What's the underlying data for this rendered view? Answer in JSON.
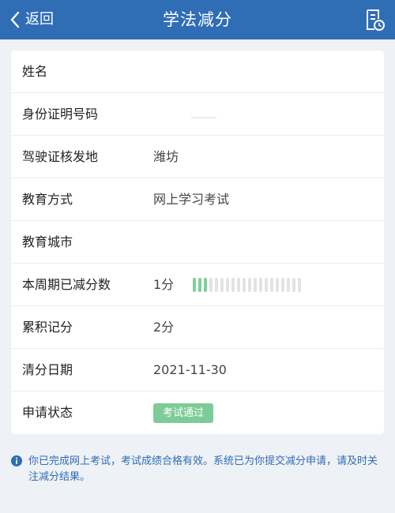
{
  "header": {
    "back_label": "返回",
    "title": "学法减分",
    "icons": {
      "back": "chevron-left-icon",
      "document": "document-clock-icon"
    },
    "color": "#2f6db5"
  },
  "rows": [
    {
      "label": "姓名",
      "value": ""
    },
    {
      "label": "身份证明号码",
      "value": ""
    },
    {
      "label": "驾驶证核发地",
      "value": "潍坊"
    },
    {
      "label": "教育方式",
      "value": "网上学习考试"
    },
    {
      "label": "教育城市",
      "value": ""
    },
    {
      "label": "本周期已减分数",
      "value": "1分",
      "progress": {
        "filled": 3,
        "total": 20
      }
    },
    {
      "label": "累积记分",
      "value": "2分"
    },
    {
      "label": "清分日期",
      "value": "2021-11-30"
    },
    {
      "label": "申请状态",
      "badge": "考试通过"
    }
  ],
  "notice": {
    "icon": "info-icon",
    "text": "你已完成网上考试，考试成绩合格有效。系统已为你提交减分申请，请及时关注减分结果。"
  },
  "colors": {
    "accent": "#2f6db5",
    "success": "#7dcc97",
    "progress_fill": "#7ed09a"
  }
}
